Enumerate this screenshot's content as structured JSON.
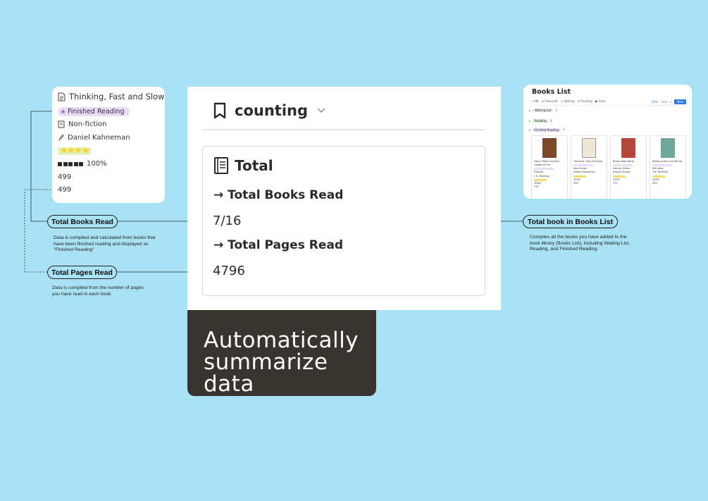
{
  "book_card": {
    "title": "Thinking, Fast and Slow",
    "status": "Finished Reading",
    "genre": "Non-fiction",
    "author": "Daniel Kahneman",
    "rating": "⭐⭐⭐⭐",
    "progress_percent": "100%",
    "pages_total": "499",
    "pages_read": "499"
  },
  "main_panel": {
    "view_title": "counting",
    "section_title": "Total",
    "books_read_label": "→ Total Books Read",
    "books_read_value": "7/16",
    "pages_read_label": "→ Total Pages Read",
    "pages_read_value": "4796"
  },
  "caption": {
    "line1": "Automatically",
    "line2": "summarize data"
  },
  "callouts": {
    "total_books_read": {
      "label": "Total Books Read",
      "note_lines": [
        "Data is compiled and calculated from books that",
        "have been finished reading and displayed as",
        "\"Finished Reading\""
      ]
    },
    "total_pages_read": {
      "label": "Total Pages Read",
      "note_lines": [
        "Data is compiled from the number of pages",
        "you have read in each book"
      ]
    },
    "total_books_list": {
      "label": "Total book in Books List",
      "note_lines": [
        "Compiles all the books you have added to the",
        "book library (Books List), including Waiting List,",
        "Reading, and Finished Reading."
      ]
    }
  },
  "books_list": {
    "title": "Books List",
    "tabs": [
      "All",
      "Favourite",
      "Waiting",
      "Reading",
      "Read"
    ],
    "tools": {
      "filter": "Filter",
      "sort": "Sort",
      "new": "New"
    },
    "groups": [
      {
        "label": "Waiting List",
        "count": "3",
        "color": "#e8e8e8"
      },
      {
        "label": "Reading",
        "count": "6",
        "color": "#d8f0d0"
      },
      {
        "label": "Finished Reading",
        "count": "7",
        "color": "#e9dcf5"
      }
    ],
    "books": [
      {
        "title": "Harry Potter and the Goblet of Fire",
        "genre": "Fantasy",
        "author": "J. K. Rowling",
        "progress": "100%",
        "pages": "752",
        "cover_color": "#7a4a2a"
      },
      {
        "title": "Thinking, Fast and Slow",
        "genre": "Non-fiction",
        "author": "Daniel Kahneman",
        "progress": "100%",
        "pages": "499",
        "cover_color": "#efe8d8"
      },
      {
        "title": "Brave New World",
        "genre": "Library Fiction",
        "author": "Aldous Huxley",
        "progress": "100%",
        "pages": "311",
        "cover_color": "#b5463a"
      },
      {
        "title": "Những lá thư của đời tôi",
        "genre": "Đời sống",
        "author": "Tim Marshall",
        "progress": "100%",
        "pages": "400",
        "cover_color": "#6fa89a"
      }
    ]
  },
  "colors": {
    "background": "#a9e2f4",
    "caption_bg": "#38342f",
    "status_pill": "#e9dcf5",
    "accent_blue": "#2c7be5"
  }
}
